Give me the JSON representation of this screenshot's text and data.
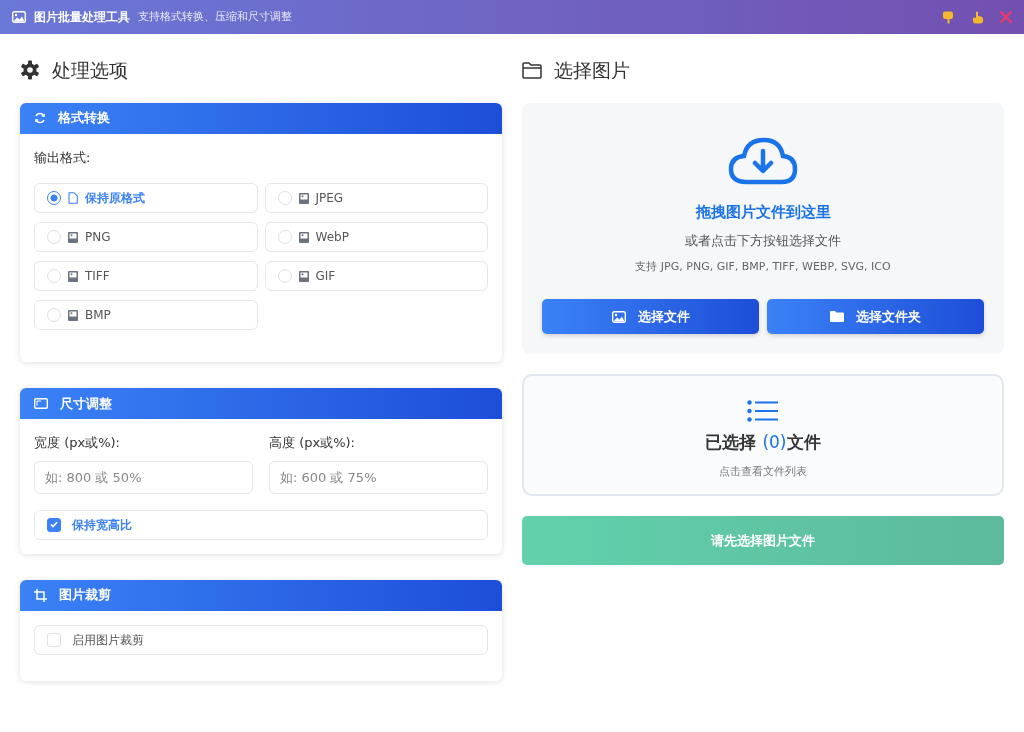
{
  "window": {
    "title": "图片批量处理工具",
    "subtitle": "支持格式转换、压缩和尺寸调整"
  },
  "options": {
    "heading": "处理选项",
    "format": {
      "title": "格式转换",
      "label": "输出格式:",
      "choices": [
        {
          "label": "保持原格式",
          "kind": "original",
          "selected": true
        },
        {
          "label": "JPEG",
          "kind": "image",
          "selected": false
        },
        {
          "label": "PNG",
          "kind": "image",
          "selected": false
        },
        {
          "label": "WebP",
          "kind": "image",
          "selected": false
        },
        {
          "label": "TIFF",
          "kind": "image",
          "selected": false
        },
        {
          "label": "GIF",
          "kind": "image",
          "selected": false
        },
        {
          "label": "BMP",
          "kind": "image",
          "selected": false
        }
      ]
    },
    "resize": {
      "title": "尺寸调整",
      "fields": [
        {
          "label": "宽度 (px或%):",
          "placeholder": "如: 800 或 50%"
        },
        {
          "label": "高度 (px或%):",
          "placeholder": "如: 600 或 75%"
        }
      ],
      "keep_ratio": {
        "label": "保持宽高比",
        "checked": true
      }
    },
    "crop": {
      "title": "图片裁剪",
      "enable": {
        "label": "启用图片裁剪",
        "checked": false
      }
    }
  },
  "select": {
    "heading": "选择图片",
    "dropzone": {
      "title": "拖拽图片文件到这里",
      "hint": "或者点击下方按钮选择文件",
      "formats": "支持 JPG, PNG, GIF, BMP, TIFF, WEBP, SVG, ICO",
      "buttons": [
        {
          "label": "选择文件",
          "kind": "file"
        },
        {
          "label": "选择文件夹",
          "kind": "folder"
        }
      ]
    },
    "selected": {
      "prefix": "已选择",
      "count": "(0)",
      "suffix": "文件",
      "hint": "点击查看文件列表"
    },
    "start": {
      "label": "请先选择图片文件",
      "disabled": true
    }
  }
}
